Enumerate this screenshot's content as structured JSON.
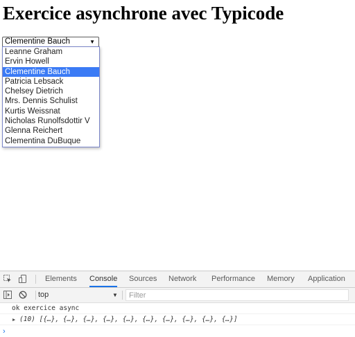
{
  "page": {
    "title": "Exercice asynchrone avec Typicode"
  },
  "user_select": {
    "selected": "Clementine Bauch",
    "options": [
      "Leanne Graham",
      "Ervin Howell",
      "Clementine Bauch",
      "Patricia Lebsack",
      "Chelsey Dietrich",
      "Mrs. Dennis Schulist",
      "Kurtis Weissnat",
      "Nicholas Runolfsdottir V",
      "Glenna Reichert",
      "Clementina DuBuque"
    ],
    "highlight_color": "#3b7bf5"
  },
  "devtools": {
    "tabs": [
      "Elements",
      "Console",
      "Sources",
      "Network",
      "Performance",
      "Memory",
      "Application"
    ],
    "active_tab": "Console",
    "context": "top",
    "filter_placeholder": "Filter",
    "console_lines": [
      "ok exercice async",
      "(10) [{…}, {…}, {…}, {…}, {…}, {…}, {…}, {…}, {…}, {…}]"
    ],
    "prompt_symbol": "›",
    "accent_color": "#1a73e8",
    "icons": [
      "inspect-element-icon",
      "device-toolbar-icon",
      "console-sidebar-icon",
      "clear-console-icon",
      "dropdown-arrow-icon",
      "expand-triangle-icon"
    ]
  }
}
